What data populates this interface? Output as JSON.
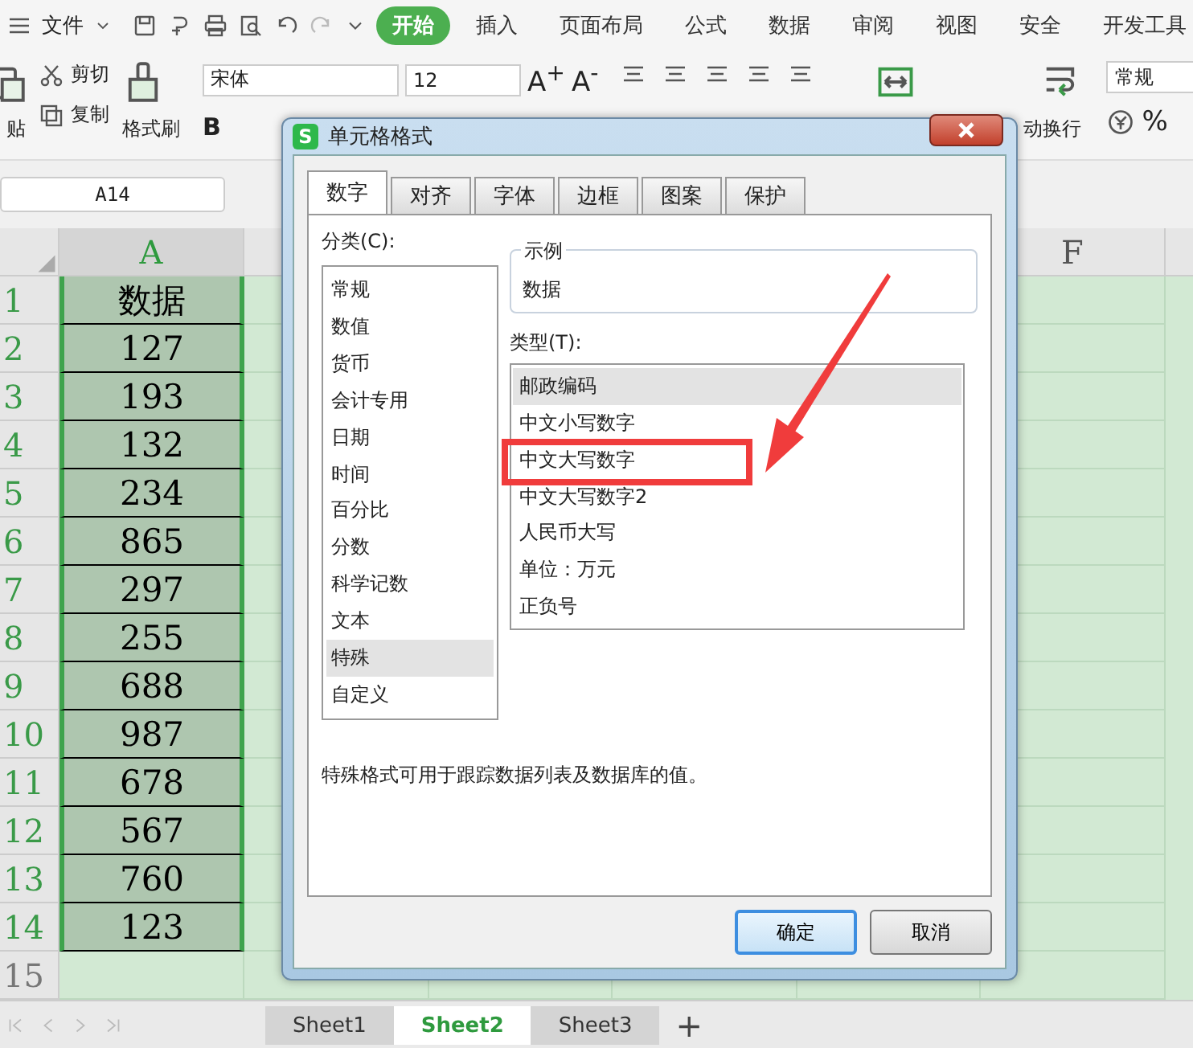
{
  "menu_bar": {
    "file_menu": "文件",
    "tabs": [
      {
        "label": "开始",
        "selected": true
      },
      {
        "label": "插入",
        "selected": false
      },
      {
        "label": "页面布局",
        "selected": false
      },
      {
        "label": "公式",
        "selected": false
      },
      {
        "label": "数据",
        "selected": false
      },
      {
        "label": "审阅",
        "selected": false
      },
      {
        "label": "视图",
        "selected": false
      },
      {
        "label": "安全",
        "selected": false
      },
      {
        "label": "开发工具",
        "selected": false
      }
    ]
  },
  "ribbon": {
    "paste": "贴",
    "cut": "剪切",
    "copy": "复制",
    "format_painter": "格式刷",
    "font_name": "宋体",
    "font_size": "12",
    "grow_font": "A$^{+}$",
    "shrink_font": "A$^{-}$",
    "bold": "B",
    "wrap_text": "动换行",
    "number_format": "常规",
    "percent": "%"
  },
  "name_box": "A14",
  "sheet": {
    "columns": [
      {
        "label": "A",
        "selected": true
      },
      {
        "label": "F",
        "selected": false
      }
    ],
    "rows": [
      {
        "number": "1",
        "value": "数据",
        "selected": true
      },
      {
        "number": "2",
        "value": "127",
        "selected": true
      },
      {
        "number": "3",
        "value": "193",
        "selected": true
      },
      {
        "number": "4",
        "value": "132",
        "selected": true
      },
      {
        "number": "5",
        "value": "234",
        "selected": true
      },
      {
        "number": "6",
        "value": "865",
        "selected": true
      },
      {
        "number": "7",
        "value": "297",
        "selected": true
      },
      {
        "number": "8",
        "value": "255",
        "selected": true
      },
      {
        "number": "9",
        "value": "688",
        "selected": true
      },
      {
        "number": "10",
        "value": "987",
        "selected": true
      },
      {
        "number": "11",
        "value": "678",
        "selected": true
      },
      {
        "number": "12",
        "value": "567",
        "selected": true
      },
      {
        "number": "13",
        "value": "760",
        "selected": true
      },
      {
        "number": "14",
        "value": "123",
        "selected": true
      },
      {
        "number": "15",
        "selected": false
      }
    ]
  },
  "sheet_tabs": [
    {
      "label": "Sheet1",
      "selected": false
    },
    {
      "label": "Sheet2",
      "selected": true
    },
    {
      "label": "Sheet3",
      "selected": false
    }
  ],
  "add_sheet": "+",
  "dialog": {
    "icon": "S",
    "title": "单元格格式",
    "tabs": [
      {
        "label": "数字",
        "selected": true
      },
      {
        "label": "对齐",
        "selected": false
      },
      {
        "label": "字体",
        "selected": false
      },
      {
        "label": "边框",
        "selected": false
      },
      {
        "label": "图案",
        "selected": false
      },
      {
        "label": "保护",
        "selected": false
      }
    ],
    "category_label": "分类(C):",
    "categories": [
      {
        "label": "常规",
        "selected": false
      },
      {
        "label": "数值",
        "selected": false
      },
      {
        "label": "货币",
        "selected": false
      },
      {
        "label": "会计专用",
        "selected": false
      },
      {
        "label": "日期",
        "selected": false
      },
      {
        "label": "时间",
        "selected": false
      },
      {
        "label": "百分比",
        "selected": false
      },
      {
        "label": "分数",
        "selected": false
      },
      {
        "label": "科学记数",
        "selected": false
      },
      {
        "label": "文本",
        "selected": false
      },
      {
        "label": "特殊",
        "selected": true
      },
      {
        "label": "自定义",
        "selected": false
      }
    ],
    "sample_label": "示例",
    "sample_value": "数据",
    "type_label": "类型(T):",
    "types": [
      {
        "label": "邮政编码",
        "selected": true,
        "highlighted": false
      },
      {
        "label": "中文小写数字",
        "selected": false,
        "highlighted": false
      },
      {
        "label": "中文大写数字",
        "selected": false,
        "highlighted": true
      },
      {
        "label": "中文大写数字2",
        "selected": false,
        "highlighted": false
      },
      {
        "label": "人民币大写",
        "selected": false,
        "highlighted": false
      },
      {
        "label": "单位：万元",
        "selected": false,
        "highlighted": false
      },
      {
        "label": "正负号",
        "selected": false,
        "highlighted": false
      }
    ],
    "description": "特殊格式可用于跟踪数据列表及数据库的值。",
    "buttons": [
      {
        "label": "确定",
        "kind": "default"
      },
      {
        "label": "取消",
        "kind": "normal"
      }
    ]
  }
}
